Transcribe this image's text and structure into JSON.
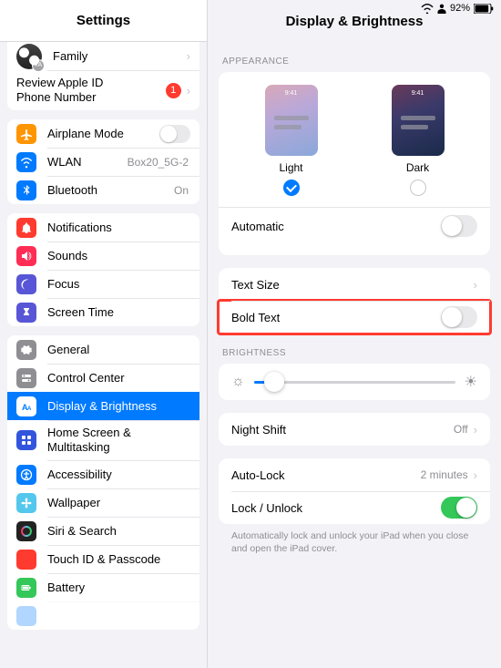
{
  "statusbar": {
    "battery_pct": "92%"
  },
  "sidebar": {
    "title": "Settings",
    "family": {
      "label": "Family",
      "avatar_badge": "TA"
    },
    "review": {
      "line1": "Review Apple ID",
      "line2": "Phone Number",
      "badge": "1"
    },
    "airplane": "Airplane Mode",
    "wlan": {
      "label": "WLAN",
      "value": "Box20_5G-2"
    },
    "bluetooth": {
      "label": "Bluetooth",
      "value": "On"
    },
    "notifications": "Notifications",
    "sounds": "Sounds",
    "focus": "Focus",
    "screentime": "Screen Time",
    "general": "General",
    "controlcenter": "Control Center",
    "display": "Display & Brightness",
    "homescreen": {
      "line1": "Home Screen &",
      "line2": "Multitasking"
    },
    "accessibility": "Accessibility",
    "wallpaper": "Wallpaper",
    "siri": "Siri & Search",
    "touchid": "Touch ID & Passcode",
    "battery": "Battery"
  },
  "detail": {
    "title": "Display & Brightness",
    "sections": {
      "appearance": "Appearance",
      "brightness": "Brightness"
    },
    "appearance": {
      "light": "Light",
      "dark": "Dark",
      "wallpaper_time": "9:41",
      "automatic": "Automatic"
    },
    "textsize": "Text Size",
    "boldtext": "Bold Text",
    "nightshift": {
      "label": "Night Shift",
      "value": "Off"
    },
    "autolock": {
      "label": "Auto-Lock",
      "value": "2 minutes"
    },
    "lockunlock": "Lock / Unlock",
    "footnote": "Automatically lock and unlock your iPad when you close and open the iPad cover."
  },
  "colors": {
    "airplane": "#ff9500",
    "wlan": "#007aff",
    "bluetooth": "#007aff",
    "notifications": "#ff3b30",
    "sounds": "#ff2d55",
    "focus": "#5856d6",
    "screentime": "#5856d6",
    "general": "#8e8e93",
    "controlcenter": "#8e8e93",
    "display": "#007aff",
    "homescreen": "#3355dd",
    "accessibility": "#007aff",
    "wallpaper": "#54c7ec",
    "siri": "#222",
    "touchid": "#ff3b30",
    "battery": "#34c759"
  }
}
